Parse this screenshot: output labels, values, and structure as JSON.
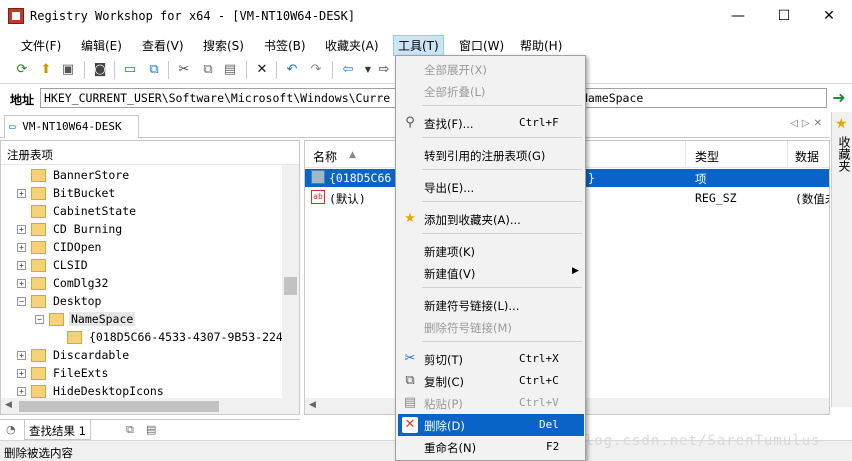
{
  "window": {
    "title": "Registry Workshop for x64 - [VM-NT10W64-DESK]",
    "minimize": "—",
    "maximize": "☐",
    "close": "✕"
  },
  "menubar": [
    {
      "label": "文件(F)"
    },
    {
      "label": "编辑(E)"
    },
    {
      "label": "查看(V)"
    },
    {
      "label": "搜索(S)"
    },
    {
      "label": "书签(B)"
    },
    {
      "label": "收藏夹(A)"
    },
    {
      "label": "工具(T)"
    },
    {
      "label": "窗口(W)"
    },
    {
      "label": "帮助(H)"
    }
  ],
  "toolbar": {
    "icons": [
      "refresh-icon",
      "import-icon",
      "save-icon",
      "snapshot-icon",
      "computer-icon",
      "remote-icon",
      "cut-icon",
      "copy-icon",
      "paste-icon",
      "delete-icon",
      "undo-icon",
      "redo-icon",
      "back-icon",
      "forward-icon"
    ]
  },
  "address": {
    "label": "地址",
    "value": "HKEY_CURRENT_USER\\Software\\Microsoft\\Windows\\Curre",
    "value_tail": "NameSpace"
  },
  "tab": {
    "label": "VM-NT10W64-DESK"
  },
  "fav_panel": {
    "label": "收藏夹"
  },
  "tree": {
    "header": "注册表项",
    "items": [
      {
        "label": "BannerStore",
        "expander": ""
      },
      {
        "label": "BitBucket",
        "expander": "+"
      },
      {
        "label": "CabinetState",
        "expander": ""
      },
      {
        "label": "CD Burning",
        "expander": "+"
      },
      {
        "label": "CIDOpen",
        "expander": "+"
      },
      {
        "label": "CLSID",
        "expander": "+"
      },
      {
        "label": "ComDlg32",
        "expander": "+"
      },
      {
        "label": "Desktop",
        "expander": "−"
      },
      {
        "label": "NameSpace",
        "expander": "−"
      },
      {
        "label": "{018D5C66-4533-4307-9B53-224",
        "expander": ""
      },
      {
        "label": "Discardable",
        "expander": "+"
      },
      {
        "label": "FileExts",
        "expander": "+"
      },
      {
        "label": "HideDesktopIcons",
        "expander": "+"
      }
    ]
  },
  "list": {
    "columns": [
      "名称",
      "类型",
      "数据"
    ],
    "rows": [
      {
        "name": "{018D5C66",
        "name_tail": "}",
        "type": "项",
        "data": ""
      },
      {
        "name": "(默认)",
        "type": "REG_SZ",
        "data": "(数值未"
      }
    ]
  },
  "bottom_tabs": {
    "find_label": "查找结果 1"
  },
  "status": {
    "text": "删除被选内容"
  },
  "watermark": "https://blog.csdn.net/SarenTumulus",
  "context_menu": {
    "items": [
      {
        "label": "全部展开(X)",
        "shortcut": "",
        "disabled": true
      },
      {
        "label": "全部折叠(L)",
        "shortcut": "",
        "disabled": true
      },
      {
        "label": "查找(F)...",
        "shortcut": "Ctrl+F",
        "icon": "search-icon"
      },
      {
        "label": "转到引用的注册表项(G)",
        "shortcut": ""
      },
      {
        "label": "导出(E)...",
        "shortcut": ""
      },
      {
        "label": "添加到收藏夹(A)...",
        "shortcut": "",
        "icon": "star-icon"
      },
      {
        "label": "新建项(K)",
        "shortcut": ""
      },
      {
        "label": "新建值(V)",
        "shortcut": "",
        "submenu": true
      },
      {
        "label": "新建符号链接(L)...",
        "shortcut": ""
      },
      {
        "label": "删除符号链接(M)",
        "shortcut": "",
        "disabled": true
      },
      {
        "label": "剪切(T)",
        "shortcut": "Ctrl+X",
        "icon": "cut-icon"
      },
      {
        "label": "复制(C)",
        "shortcut": "Ctrl+C",
        "icon": "copy-icon"
      },
      {
        "label": "粘贴(P)",
        "shortcut": "Ctrl+V",
        "icon": "paste-icon",
        "disabled": true
      },
      {
        "label": "删除(D)",
        "shortcut": "Del",
        "icon": "delete-icon",
        "highlighted": true
      },
      {
        "label": "重命名(N)",
        "shortcut": "F2"
      }
    ]
  }
}
